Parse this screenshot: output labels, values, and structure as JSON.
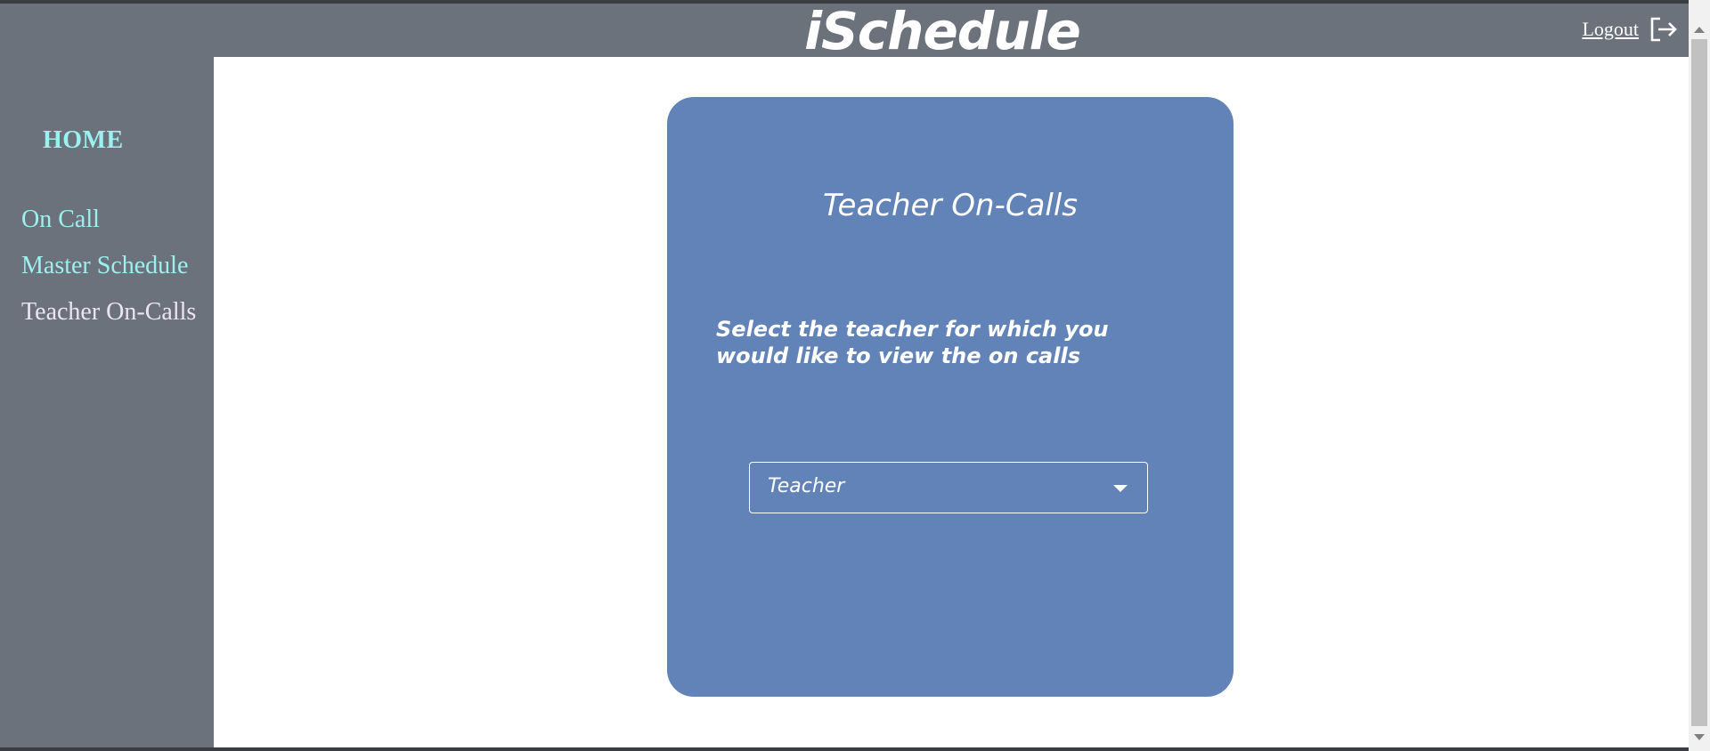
{
  "header": {
    "brand": "iSchedule",
    "logout_label": "Logout",
    "logout_icon": "logout-icon"
  },
  "sidebar": {
    "home_label": "HOME",
    "items": [
      {
        "label": "On Call",
        "active": false
      },
      {
        "label": "Master Schedule",
        "active": false
      },
      {
        "label": "Teacher On-Calls",
        "active": true
      }
    ]
  },
  "card": {
    "title": "Teacher On-Calls",
    "description": "Select the teacher for which you would like to view the on calls",
    "select": {
      "value": "Teacher"
    }
  },
  "colors": {
    "chrome": "#6c727c",
    "link": "#9cf0ef",
    "active_link": "#ece4f4",
    "card": "#6283b8",
    "content_bg": "#ffffff"
  }
}
